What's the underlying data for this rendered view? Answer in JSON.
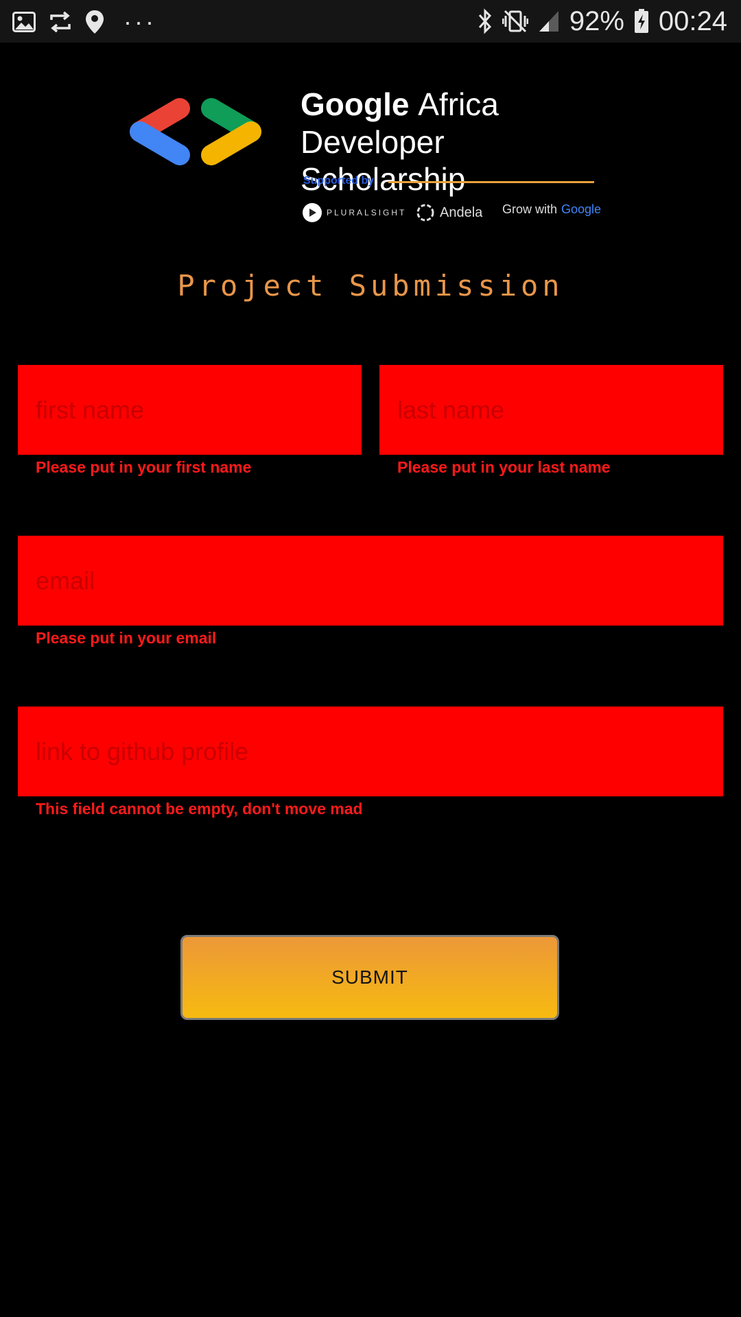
{
  "status_bar": {
    "battery": "92%",
    "time": "00:24",
    "more_indicator": "···",
    "icons": [
      "image-icon",
      "sync-icon",
      "location-icon",
      "bluetooth-icon",
      "vibrate-icon",
      "signal-icon",
      "battery-charging-icon"
    ]
  },
  "logo": {
    "brand_bold": "Google",
    "brand_light": "Africa",
    "brand_line2": "Developer Scholarship",
    "supported_by": "Supported by",
    "partners": [
      "PLURALSIGHT",
      "Andela",
      "Grow with",
      "Google"
    ]
  },
  "title": "Project Submission",
  "form": {
    "first_name": {
      "placeholder": "first name",
      "value": "",
      "error": "Please put in your first name"
    },
    "last_name": {
      "placeholder": "last name",
      "value": "",
      "error": "Please put in your last name"
    },
    "email": {
      "placeholder": "email",
      "value": "",
      "error": "Please put in your email"
    },
    "github": {
      "placeholder": "link to github profile",
      "value": "",
      "error": "This field cannot be empty, don't move mad"
    },
    "submit_label": "SUBMIT"
  },
  "colors": {
    "background": "#000000",
    "field_fill": "#ff0000",
    "error_text": "#ff1a1a",
    "title": "#e8964a",
    "button_top": "#ec9838",
    "button_bottom": "#f7ba10"
  }
}
